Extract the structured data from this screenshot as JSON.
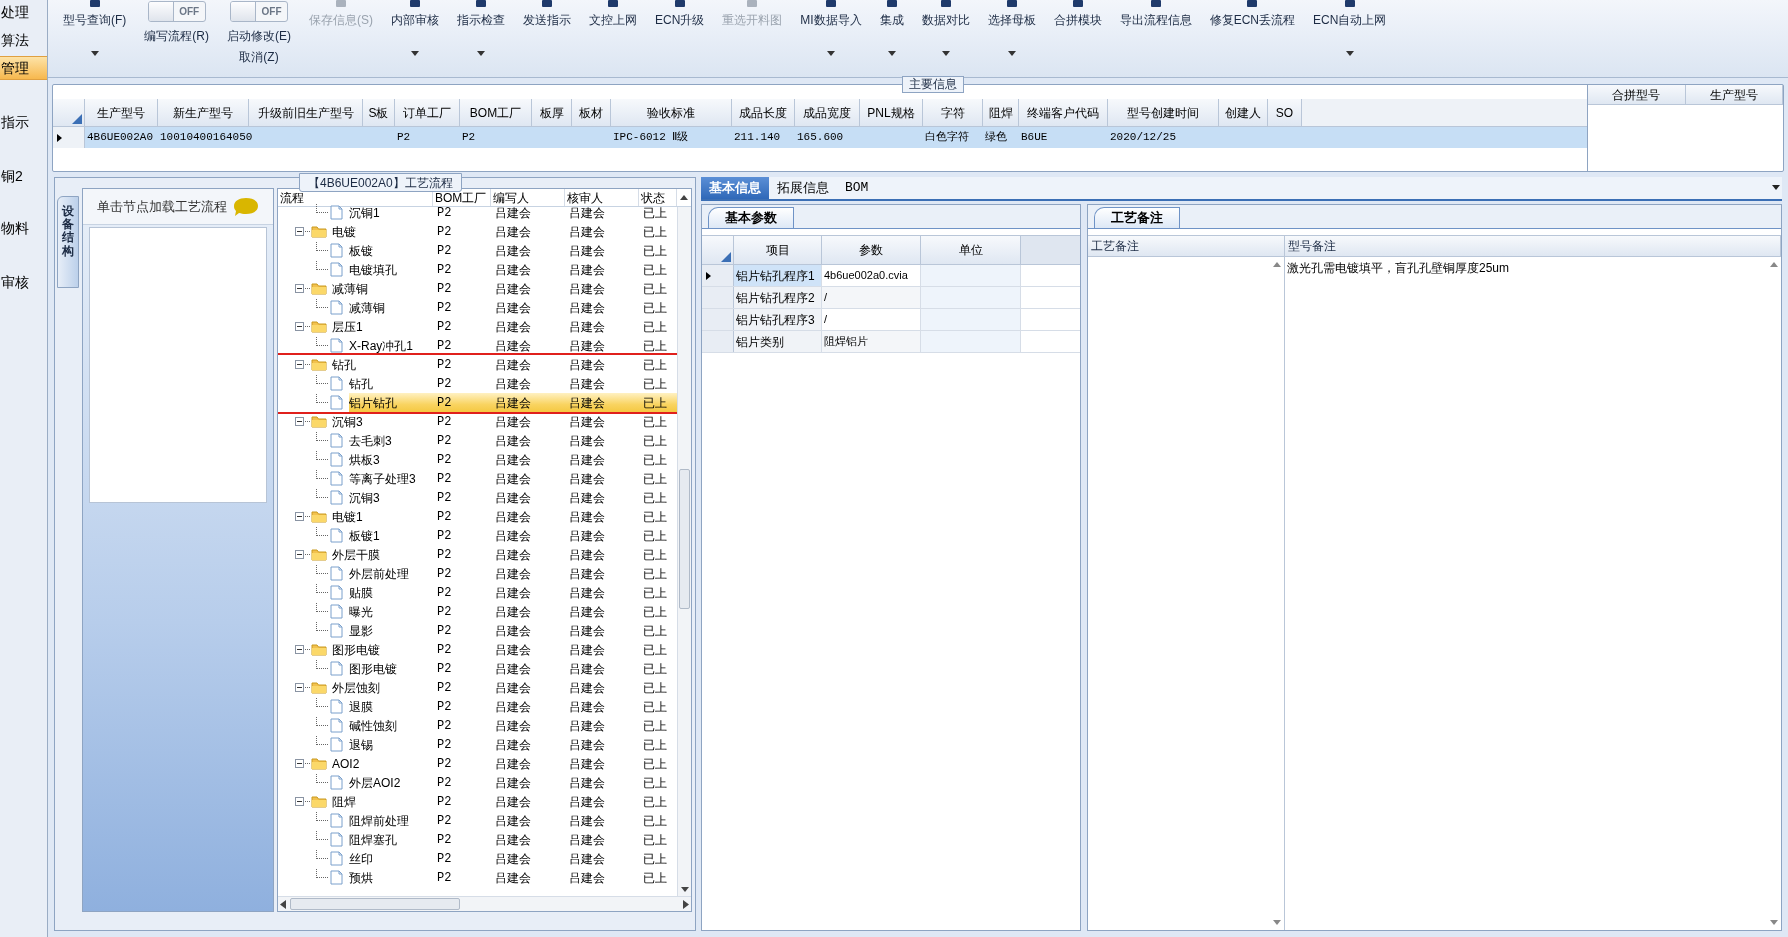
{
  "nav": [
    {
      "label": "处理",
      "selected": false
    },
    {
      "label": "算法",
      "selected": false
    },
    {
      "label": "管理",
      "selected": true
    },
    {
      "label": "指示",
      "selected": false
    },
    {
      "label": "铜2",
      "selected": false
    },
    {
      "label": "物料",
      "selected": false
    },
    {
      "label": "审核",
      "selected": false
    }
  ],
  "toolbar": [
    {
      "kind": "button",
      "label": "型号查询(F)",
      "disabled": false,
      "dropdown": true
    },
    {
      "kind": "toggle",
      "state_text": "OFF",
      "on": false,
      "label": "编写流程(R)"
    },
    {
      "kind": "toggle",
      "state_text": "OFF",
      "on": false,
      "label": "启动修改(E)",
      "label2": "取消(Z)"
    },
    {
      "kind": "button",
      "label": "保存信息(S)",
      "disabled": true,
      "dropdown": false
    },
    {
      "kind": "button",
      "label": "内部审核",
      "disabled": false,
      "dropdown": true
    },
    {
      "kind": "button",
      "label": "指示检查",
      "disabled": false,
      "dropdown": true
    },
    {
      "kind": "button",
      "label": "发送指示",
      "disabled": false,
      "dropdown": false
    },
    {
      "kind": "button",
      "label": "文控上网",
      "disabled": false,
      "dropdown": false
    },
    {
      "kind": "button",
      "label": "ECN升级",
      "disabled": false,
      "dropdown": false
    },
    {
      "kind": "button",
      "label": "重选开料图",
      "disabled": true,
      "dropdown": false
    },
    {
      "kind": "button",
      "label": "MI数据导入",
      "disabled": false,
      "dropdown": true
    },
    {
      "kind": "button",
      "label": "集成",
      "disabled": false,
      "dropdown": true
    },
    {
      "kind": "button",
      "label": "数据对比",
      "disabled": false,
      "dropdown": true
    },
    {
      "kind": "button",
      "label": "选择母板",
      "disabled": false,
      "dropdown": true
    },
    {
      "kind": "button",
      "label": "合拼模块",
      "disabled": false,
      "dropdown": false
    },
    {
      "kind": "button",
      "label": "导出流程信息",
      "disabled": false,
      "dropdown": false
    },
    {
      "kind": "button",
      "label": "修复ECN丢流程",
      "disabled": false,
      "dropdown": false
    },
    {
      "kind": "button",
      "label": "ECN自动上网",
      "disabled": false,
      "dropdown": true
    }
  ],
  "main_info": {
    "title": "主要信息",
    "columns": [
      "生产型号",
      "新生产型号",
      "升级前旧生产型号",
      "S板",
      "订单工厂",
      "BOM工厂",
      "板厚",
      "板材",
      "验收标准",
      "成品长度",
      "成品宽度",
      "PNL规格",
      "字符",
      "阻焊",
      "终端客户代码",
      "型号创建时间",
      "创建人",
      "SO"
    ],
    "rows": [
      {
        "selected": true,
        "cells": [
          "4B6UE002A0",
          "10010400164050",
          "",
          "",
          "P2",
          "P2",
          "",
          "",
          "IPC-6012 Ⅱ级",
          "211.140",
          "165.600",
          "",
          "白色字符",
          "绿色",
          "B6UE",
          "2020/12/25",
          "",
          ""
        ]
      }
    ],
    "side_columns": [
      "合拼型号",
      "生产型号"
    ]
  },
  "flow_panel": {
    "title": "【4B6UE002A0】工艺流程",
    "side_tab": "设备结构",
    "hint": "单击节点加载工艺流程",
    "columns": [
      "流程",
      "BOM工厂",
      "编写人",
      "核审人",
      "状态"
    ],
    "tree": [
      {
        "children": [
          {
            "kind": "leaf",
            "label": "沉铜1",
            "bom": "P2",
            "writer": "吕建会",
            "reviewer": "吕建会",
            "status": "已上",
            "selected": false
          }
        ]
      },
      {
        "kind": "folder",
        "label": "电镀",
        "expanded": true,
        "framed": false,
        "bom": "P2",
        "writer": "吕建会",
        "reviewer": "吕建会",
        "status": "已上",
        "selected": false,
        "children": [
          {
            "kind": "leaf",
            "label": "板镀",
            "bom": "P2",
            "writer": "吕建会",
            "reviewer": "吕建会",
            "status": "已上",
            "selected": false
          },
          {
            "kind": "leaf",
            "label": "电镀填孔",
            "bom": "P2",
            "writer": "吕建会",
            "reviewer": "吕建会",
            "status": "已上",
            "selected": false
          }
        ]
      },
      {
        "kind": "folder",
        "label": "减薄铜",
        "expanded": true,
        "framed": false,
        "bom": "P2",
        "writer": "吕建会",
        "reviewer": "吕建会",
        "status": "已上",
        "selected": false,
        "children": [
          {
            "kind": "leaf",
            "label": "减薄铜",
            "bom": "P2",
            "writer": "吕建会",
            "reviewer": "吕建会",
            "status": "已上",
            "selected": false
          }
        ]
      },
      {
        "kind": "folder",
        "label": "层压1",
        "expanded": true,
        "framed": false,
        "bom": "P2",
        "writer": "吕建会",
        "reviewer": "吕建会",
        "status": "已上",
        "selected": false,
        "children": [
          {
            "kind": "leaf",
            "label": "X-Ray冲孔1",
            "bom": "P2",
            "writer": "吕建会",
            "reviewer": "吕建会",
            "status": "已上",
            "selected": false
          }
        ]
      },
      {
        "kind": "folder",
        "label": "钻孔",
        "expanded": true,
        "framed": true,
        "bom": "P2",
        "writer": "吕建会",
        "reviewer": "吕建会",
        "status": "已上",
        "selected": false,
        "children": [
          {
            "kind": "leaf",
            "label": "钻孔",
            "bom": "P2",
            "writer": "吕建会",
            "reviewer": "吕建会",
            "status": "已上",
            "selected": false
          },
          {
            "kind": "leaf",
            "label": "铝片钻孔",
            "bom": "P2",
            "writer": "吕建会",
            "reviewer": "吕建会",
            "status": "已上",
            "selected": true
          }
        ]
      },
      {
        "kind": "folder",
        "label": "沉铜3",
        "expanded": true,
        "framed": false,
        "bom": "P2",
        "writer": "吕建会",
        "reviewer": "吕建会",
        "status": "已上",
        "selected": false,
        "children": [
          {
            "kind": "leaf",
            "label": "去毛刺3",
            "bom": "P2",
            "writer": "吕建会",
            "reviewer": "吕建会",
            "status": "已上",
            "selected": false
          },
          {
            "kind": "leaf",
            "label": "烘板3",
            "bom": "P2",
            "writer": "吕建会",
            "reviewer": "吕建会",
            "status": "已上",
            "selected": false
          },
          {
            "kind": "leaf",
            "label": "等离子处理3",
            "bom": "P2",
            "writer": "吕建会",
            "reviewer": "吕建会",
            "status": "已上",
            "selected": false
          },
          {
            "kind": "leaf",
            "label": "沉铜3",
            "bom": "P2",
            "writer": "吕建会",
            "reviewer": "吕建会",
            "status": "已上",
            "selected": false
          }
        ]
      },
      {
        "kind": "folder",
        "label": "电镀1",
        "expanded": true,
        "framed": false,
        "bom": "P2",
        "writer": "吕建会",
        "reviewer": "吕建会",
        "status": "已上",
        "selected": false,
        "children": [
          {
            "kind": "leaf",
            "label": "板镀1",
            "bom": "P2",
            "writer": "吕建会",
            "reviewer": "吕建会",
            "status": "已上",
            "selected": false
          }
        ]
      },
      {
        "kind": "folder",
        "label": "外层干膜",
        "expanded": true,
        "framed": false,
        "bom": "P2",
        "writer": "吕建会",
        "reviewer": "吕建会",
        "status": "已上",
        "selected": false,
        "children": [
          {
            "kind": "leaf",
            "label": "外层前处理",
            "bom": "P2",
            "writer": "吕建会",
            "reviewer": "吕建会",
            "status": "已上",
            "selected": false
          },
          {
            "kind": "leaf",
            "label": "贴膜",
            "bom": "P2",
            "writer": "吕建会",
            "reviewer": "吕建会",
            "status": "已上",
            "selected": false
          },
          {
            "kind": "leaf",
            "label": "曝光",
            "bom": "P2",
            "writer": "吕建会",
            "reviewer": "吕建会",
            "status": "已上",
            "selected": false
          },
          {
            "kind": "leaf",
            "label": "显影",
            "bom": "P2",
            "writer": "吕建会",
            "reviewer": "吕建会",
            "status": "已上",
            "selected": false
          }
        ]
      },
      {
        "kind": "folder",
        "label": "图形电镀",
        "expanded": true,
        "framed": false,
        "bom": "P2",
        "writer": "吕建会",
        "reviewer": "吕建会",
        "status": "已上",
        "selected": false,
        "children": [
          {
            "kind": "leaf",
            "label": "图形电镀",
            "bom": "P2",
            "writer": "吕建会",
            "reviewer": "吕建会",
            "status": "已上",
            "selected": false
          }
        ]
      },
      {
        "kind": "folder",
        "label": "外层蚀刻",
        "expanded": true,
        "framed": false,
        "bom": "P2",
        "writer": "吕建会",
        "reviewer": "吕建会",
        "status": "已上",
        "selected": false,
        "children": [
          {
            "kind": "leaf",
            "label": "退膜",
            "bom": "P2",
            "writer": "吕建会",
            "reviewer": "吕建会",
            "status": "已上",
            "selected": false
          },
          {
            "kind": "leaf",
            "label": "碱性蚀刻",
            "bom": "P2",
            "writer": "吕建会",
            "reviewer": "吕建会",
            "status": "已上",
            "selected": false
          },
          {
            "kind": "leaf",
            "label": "退锡",
            "bom": "P2",
            "writer": "吕建会",
            "reviewer": "吕建会",
            "status": "已上",
            "selected": false
          }
        ]
      },
      {
        "kind": "folder",
        "label": "AOI2",
        "expanded": true,
        "framed": false,
        "bom": "P2",
        "writer": "吕建会",
        "reviewer": "吕建会",
        "status": "已上",
        "selected": false,
        "children": [
          {
            "kind": "leaf",
            "label": "外层AOI2",
            "bom": "P2",
            "writer": "吕建会",
            "reviewer": "吕建会",
            "status": "已上",
            "selected": false
          }
        ]
      },
      {
        "kind": "folder",
        "label": "阻焊",
        "expanded": true,
        "framed": false,
        "bom": "P2",
        "writer": "吕建会",
        "reviewer": "吕建会",
        "status": "已上",
        "selected": false,
        "children": [
          {
            "kind": "leaf",
            "label": "阻焊前处理",
            "bom": "P2",
            "writer": "吕建会",
            "reviewer": "吕建会",
            "status": "已上",
            "selected": false
          },
          {
            "kind": "leaf",
            "label": "阻焊塞孔",
            "bom": "P2",
            "writer": "吕建会",
            "reviewer": "吕建会",
            "status": "已上",
            "selected": false
          },
          {
            "kind": "leaf",
            "label": "丝印",
            "bom": "P2",
            "writer": "吕建会",
            "reviewer": "吕建会",
            "status": "已上",
            "selected": false
          },
          {
            "kind": "leaf",
            "label": "预烘",
            "bom": "P2",
            "writer": "吕建会",
            "reviewer": "吕建会",
            "status": "已上",
            "selected": false
          }
        ]
      }
    ]
  },
  "detail_tabs": [
    {
      "label": "基本信息",
      "selected": true
    },
    {
      "label": "拓展信息",
      "selected": false
    },
    {
      "label": "BOM",
      "selected": false
    }
  ],
  "basic_params": {
    "tab": "基本参数",
    "columns": [
      "项目",
      "参数",
      "单位"
    ],
    "rows": [
      {
        "selected": true,
        "item": "铝片钻孔程序1",
        "value": "4b6ue002a0.cvia"
      },
      {
        "selected": false,
        "item": "铝片钻孔程序2",
        "value": "/"
      },
      {
        "selected": false,
        "item": "铝片钻孔程序3",
        "value": "/"
      },
      {
        "selected": false,
        "item": "铝片类别",
        "value": "阻焊铝片"
      }
    ]
  },
  "process_notes": {
    "tab": "工艺备注",
    "columns": [
      "工艺备注",
      "型号备注"
    ],
    "model_note": "激光孔需电镀填平，盲孔孔壁铜厚度25um"
  }
}
